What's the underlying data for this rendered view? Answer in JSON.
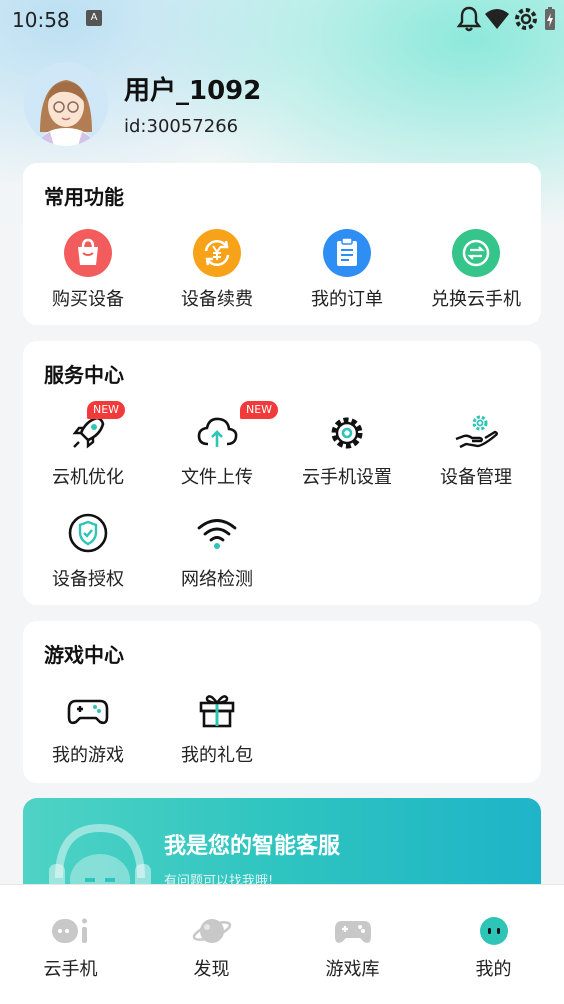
{
  "status_bar": {
    "time": "10:58",
    "notif_letter": "A"
  },
  "profile": {
    "username": "用户_1092",
    "user_id": "id:30057266"
  },
  "common": {
    "title": "常用功能",
    "items": [
      {
        "label": "购买设备",
        "icon": "shopping-bag-icon",
        "color": "#f25c5c"
      },
      {
        "label": "设备续费",
        "icon": "renew-yen-icon",
        "color": "#f8a21a"
      },
      {
        "label": "我的订单",
        "icon": "clipboard-icon",
        "color": "#2e8ef3"
      },
      {
        "label": "兑换云手机",
        "icon": "exchange-icon",
        "color": "#35c58a"
      }
    ]
  },
  "service": {
    "title": "服务中心",
    "badge": "NEW",
    "items": [
      {
        "label": "云机优化",
        "icon": "rocket-icon"
      },
      {
        "label": "文件上传",
        "icon": "cloud-upload-icon"
      },
      {
        "label": "云手机设置",
        "icon": "gear-icon"
      },
      {
        "label": "设备管理",
        "icon": "hand-gear-icon"
      },
      {
        "label": "设备授权",
        "icon": "shield-check-icon"
      },
      {
        "label": "网络检测",
        "icon": "wifi-icon"
      }
    ]
  },
  "game": {
    "title": "游戏中心",
    "items": [
      {
        "label": "我的游戏",
        "icon": "gamepad-icon"
      },
      {
        "label": "我的礼包",
        "icon": "gift-icon"
      }
    ]
  },
  "banner": {
    "title": "我是您的智能客服",
    "subtitle": "有问题可以找我哦!"
  },
  "tabbar": {
    "tabs": [
      {
        "label": "云手机",
        "icon": "cloud-phone-icon"
      },
      {
        "label": "发现",
        "icon": "planet-icon"
      },
      {
        "label": "游戏库",
        "icon": "gamepad-icon"
      },
      {
        "label": "我的",
        "icon": "face-icon",
        "active": true
      }
    ],
    "active_color": "#2ec4b6"
  }
}
